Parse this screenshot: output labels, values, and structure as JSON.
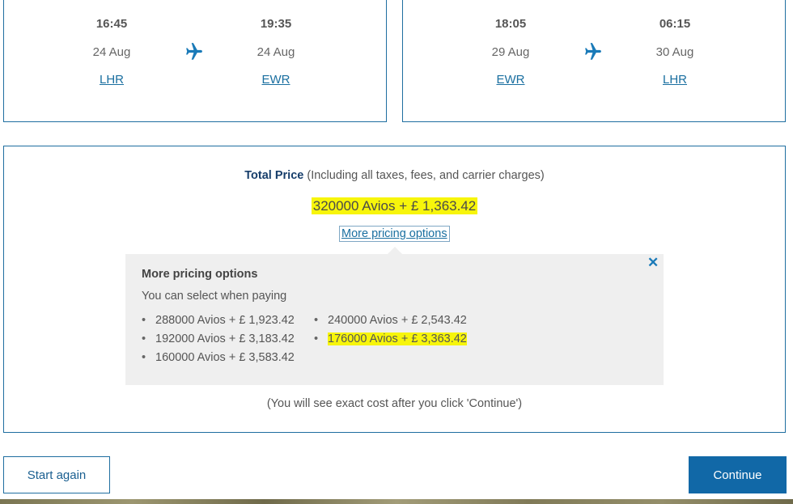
{
  "outbound": {
    "depart": {
      "time": "16:45",
      "date": "24 Aug",
      "airport": "LHR"
    },
    "arrive": {
      "time": "19:35",
      "date": "24 Aug",
      "airport": "EWR"
    }
  },
  "inbound": {
    "depart": {
      "time": "18:05",
      "date": "29 Aug",
      "airport": "EWR"
    },
    "arrive": {
      "time": "06:15",
      "date": "30 Aug",
      "airport": "LHR"
    }
  },
  "price": {
    "total_label": "Total Price",
    "total_note": "(Including all taxes, fees, and carrier charges)",
    "selected": "320000 Avios + £ 1,363.42",
    "more_link": "More pricing options",
    "popover_title": "More pricing options",
    "popover_subtitle": "You can select when paying",
    "options": [
      "288000 Avios + £ 1,923.42",
      "240000 Avios + £ 2,543.42",
      "192000 Avios + £ 3,183.42",
      "176000 Avios + £ 3,363.42",
      "160000 Avios + £ 3,583.42"
    ],
    "footnote": "(You will see exact cost after you click 'Continue')"
  },
  "buttons": {
    "start_again": "Start again",
    "continue": "Continue"
  },
  "colors": {
    "accent": "#1168a7",
    "link": "#1a6fa0",
    "highlight": "#f7f50b"
  },
  "icons": {
    "plane": "plane-icon",
    "close": "close-icon"
  }
}
